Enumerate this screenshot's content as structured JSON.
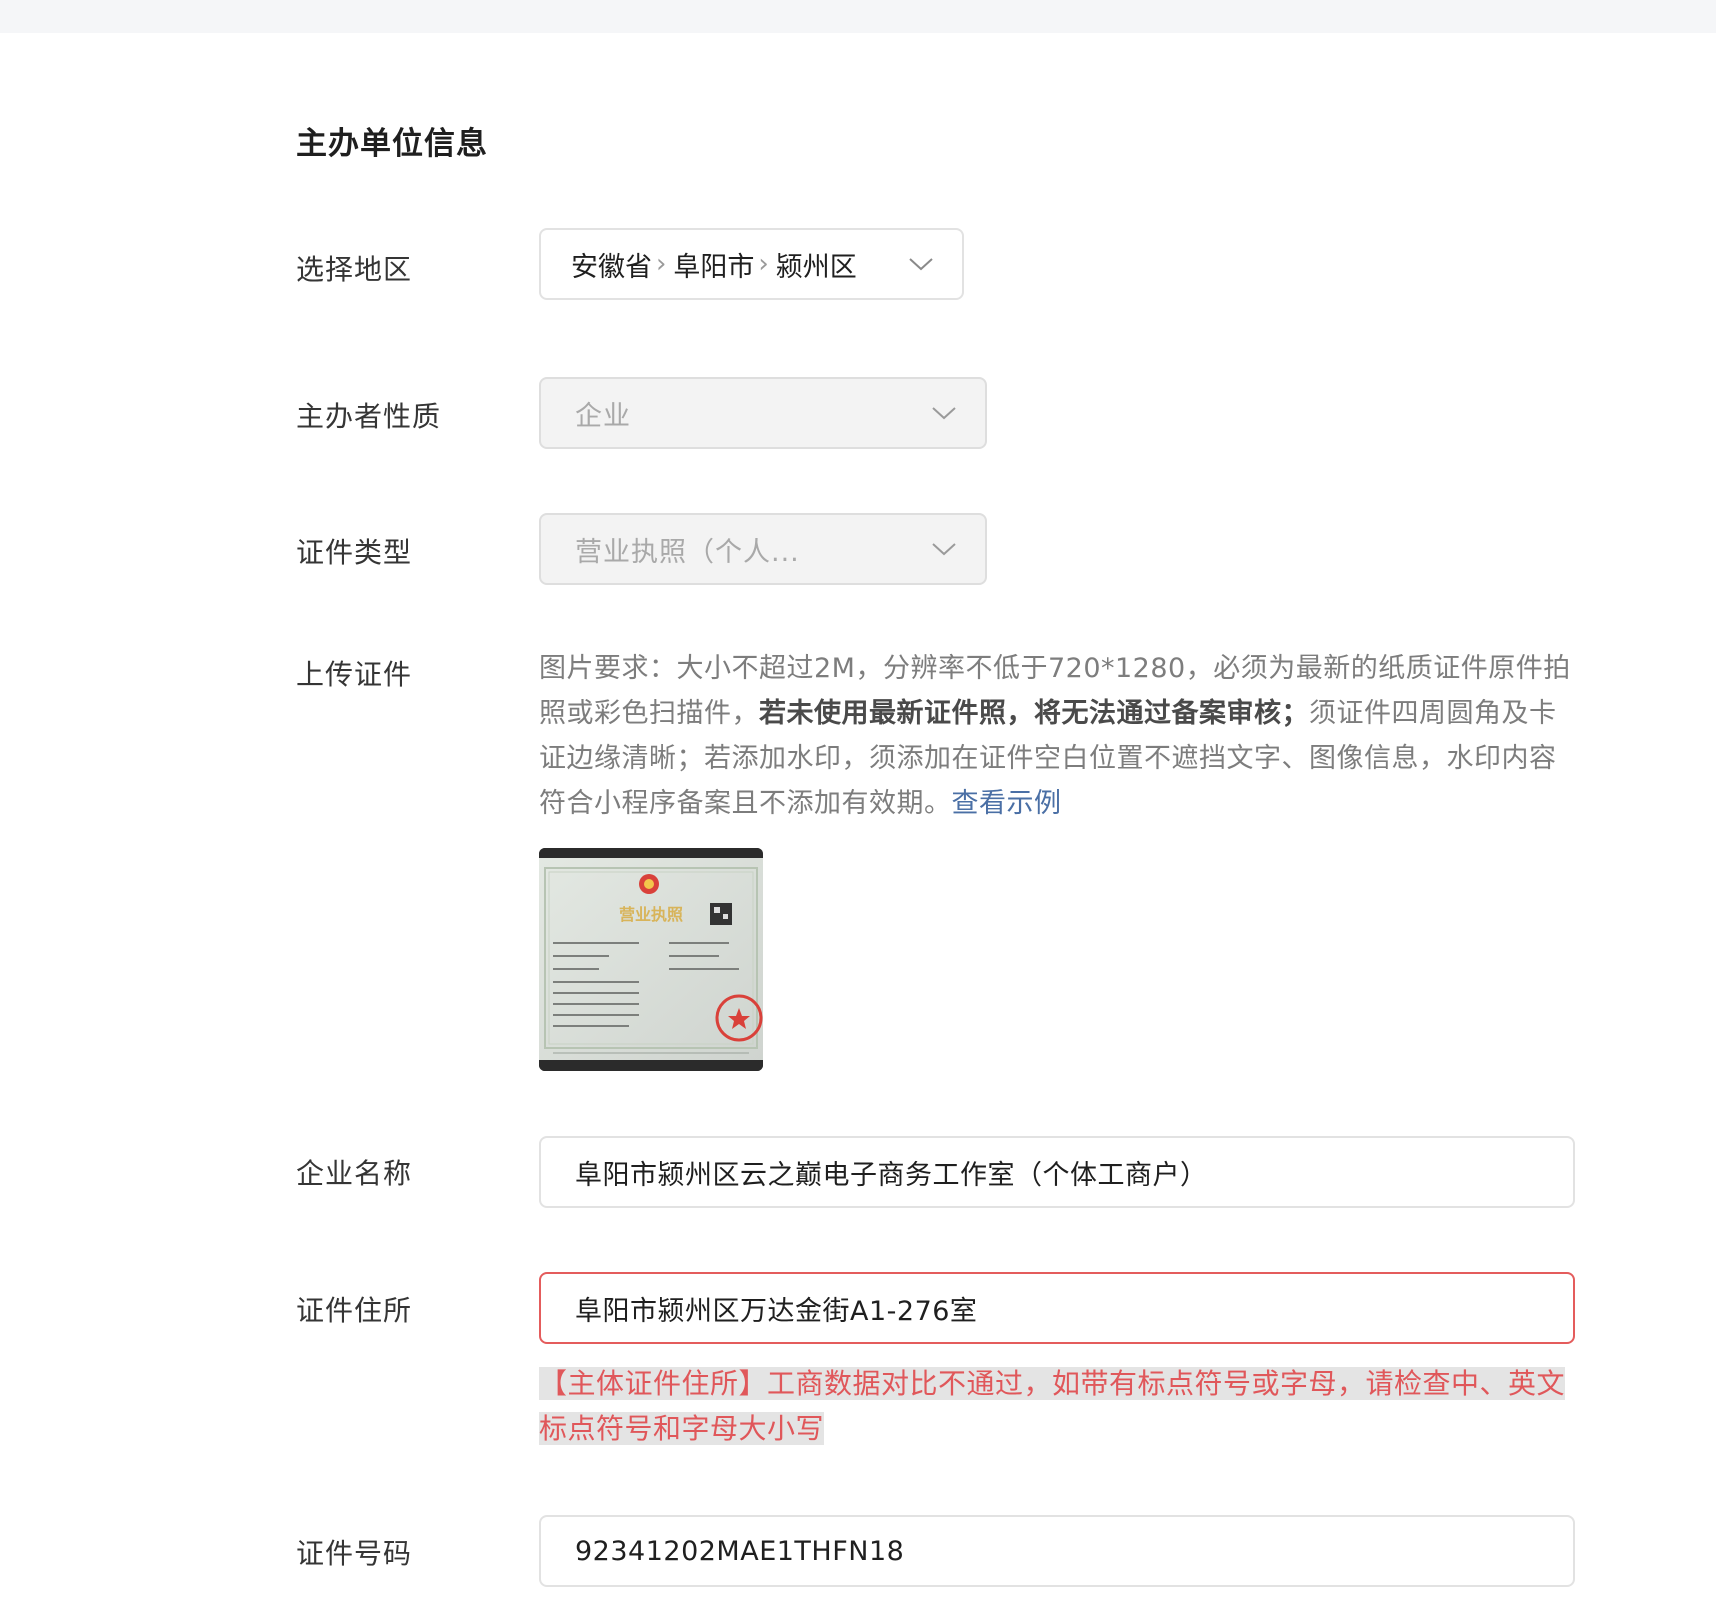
{
  "section_title": "主办单位信息",
  "region": {
    "label": "选择地区",
    "province": "安徽省",
    "city": "阜阳市",
    "district": "颍州区"
  },
  "organizer_type": {
    "label": "主办者性质",
    "value": "企业"
  },
  "certificate_type": {
    "label": "证件类型",
    "value": "营业执照（个人..."
  },
  "upload": {
    "label": "上传证件",
    "requirements_part1": "图片要求：大小不超过2M，分辨率不低于720*1280，必须为最新的纸质证件原件拍照或彩色扫描件，",
    "requirements_bold": "若未使用最新证件照，将无法通过备案审核；",
    "requirements_part2": "须证件四周圆角及卡证边缘清晰；若添加水印，须添加在证件空白位置不遮挡文字、图像信息，水印内容符合小程序备案且不添加有效期。",
    "example_link": "查看示例",
    "thumbnail_title": "营业执照"
  },
  "company_name": {
    "label": "企业名称",
    "value": "阜阳市颍州区云之巅电子商务工作室（个体工商户）"
  },
  "certificate_address": {
    "label": "证件住所",
    "value": "阜阳市颍州区万达金街A1-276室",
    "error": "【主体证件住所】工商数据对比不通过，如带有标点符号或字母，请检查中、英文标点符号和字母大小写"
  },
  "certificate_number": {
    "label": "证件号码",
    "value": "92341202MAE1THFN18"
  },
  "colors": {
    "error": "#e0575a",
    "link": "#4a6fa5",
    "border": "#e2e2e2"
  }
}
